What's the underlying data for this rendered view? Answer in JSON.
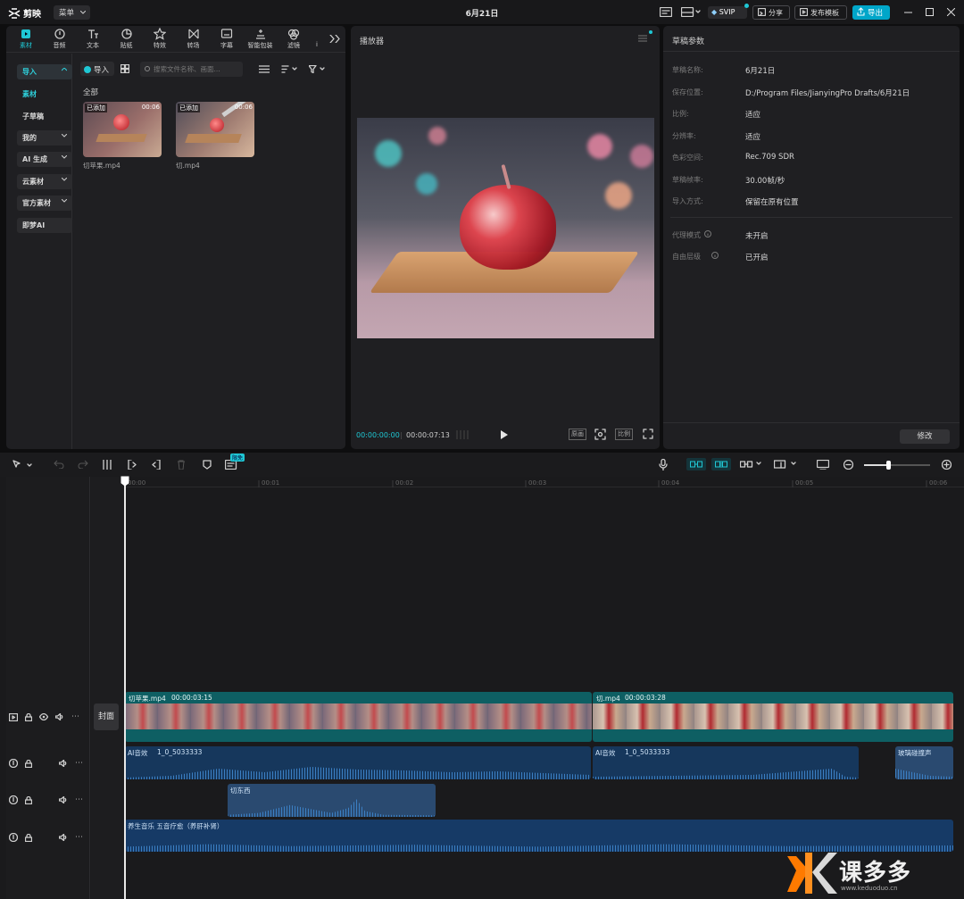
{
  "app": {
    "name": "剪映",
    "menu": "菜单",
    "doc_title": "6月21日"
  },
  "titlebar": {
    "svip": "SVIP",
    "share": "分享",
    "publish_template": "发布模板",
    "export": "导出"
  },
  "toolbar_tabs": [
    {
      "label": "素材",
      "icon": "media-icon",
      "active": true
    },
    {
      "label": "音频",
      "icon": "audio-icon"
    },
    {
      "label": "文本",
      "icon": "text-icon"
    },
    {
      "label": "贴纸",
      "icon": "sticker-icon"
    },
    {
      "label": "特效",
      "icon": "effects-icon"
    },
    {
      "label": "转场",
      "icon": "transition-icon"
    },
    {
      "label": "字幕",
      "icon": "subtitle-icon"
    },
    {
      "label": "智能包装",
      "icon": "smart-pack-icon"
    },
    {
      "label": "滤镜",
      "icon": "filter-icon"
    }
  ],
  "toolbar_more": "i",
  "sidebar": {
    "import": "导入",
    "items": [
      "素材",
      "子草稿",
      "我的",
      "AI 生成",
      "云素材",
      "官方素材",
      "即梦AI"
    ]
  },
  "media": {
    "import_btn": "导入",
    "search_placeholder": "搜索文件名称、画面...",
    "section": "全部",
    "clips": [
      {
        "name": "切苹果.mp4",
        "badge": "已添加",
        "duration": "00:06"
      },
      {
        "name": "切.mp4",
        "badge": "已添加",
        "duration": "00:06"
      }
    ]
  },
  "player": {
    "title": "播放器",
    "current_time": "00:00:00:00",
    "total_time": "00:00:07:13",
    "btn_original": "原画",
    "btn_ratio": "比例"
  },
  "draft": {
    "title": "草稿参数",
    "rows": [
      {
        "label": "草稿名称:",
        "value": "6月21日"
      },
      {
        "label": "保存位置:",
        "value": "D:/Program Files/JianyingPro Drafts/6月21日"
      },
      {
        "label": "比例:",
        "value": "适应"
      },
      {
        "label": "分辨率:",
        "value": "适应"
      },
      {
        "label": "色彩空间:",
        "value": "Rec.709 SDR"
      },
      {
        "label": "草稿帧率:",
        "value": "30.00帧/秒"
      },
      {
        "label": "导入方式:",
        "value": "保留在原有位置"
      }
    ],
    "rows2": [
      {
        "label": "代理模式",
        "value": "未开启"
      },
      {
        "label": "自由层级",
        "value": "已开启"
      }
    ],
    "modify": "修改"
  },
  "timeline": {
    "free_badge": "限免",
    "ticks": [
      "00:00",
      "00:01",
      "00:02",
      "00:03",
      "00:04",
      "00:05",
      "00:06"
    ],
    "cover": "封面",
    "video_clips": [
      {
        "name": "切苹果.mp4",
        "duration": "00:00:03:15"
      },
      {
        "name": "切.mp4",
        "duration": "00:00:03:28"
      }
    ],
    "audio_clips": [
      {
        "name": "AI音效",
        "id": "1_0_5033333"
      },
      {
        "name": "AI音效",
        "id": "1_0_5033333"
      },
      {
        "name": "玻璃碰撞声"
      }
    ],
    "sfx_clip": "切东西",
    "music_clip": "养生音乐 五音疗愈（养肝补肾）"
  },
  "watermark": "课多多",
  "watermark_url": "www.keduoduo.cn",
  "colors": {
    "accent": "#1fc7d4",
    "export_btn": "#00a6c9",
    "video_clip": "#0d6b6b",
    "audio_clip": "#16375c"
  }
}
